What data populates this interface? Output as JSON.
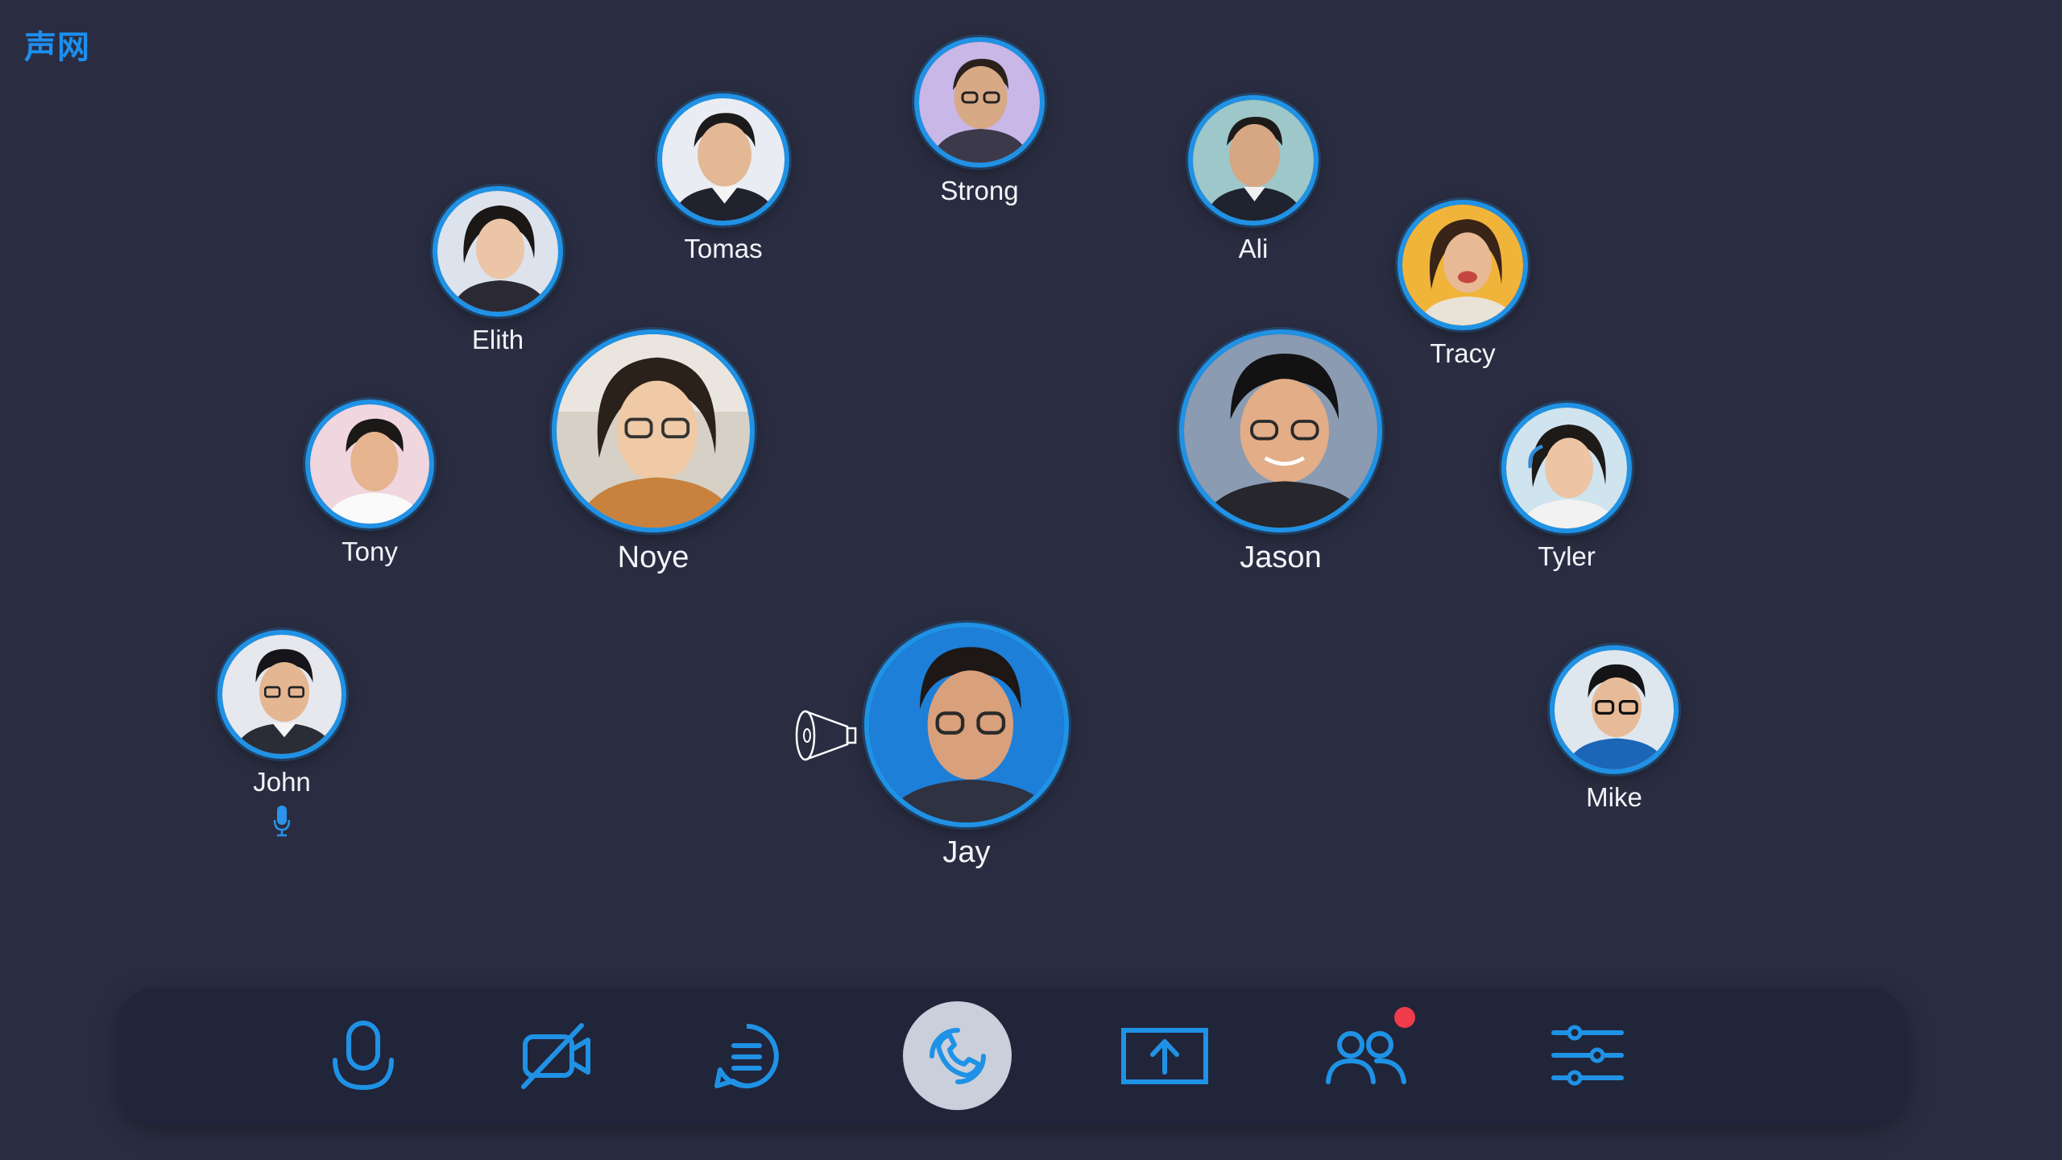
{
  "app": {
    "logo": "声网"
  },
  "participants": [
    {
      "name": "Strong",
      "bg": "#c9b7e8"
    },
    {
      "name": "Tomas",
      "bg": "#e9edf3"
    },
    {
      "name": "Ali",
      "bg": "#9ec7c9"
    },
    {
      "name": "Elith",
      "bg": "#dde3ec"
    },
    {
      "name": "Tracy",
      "bg": "#f1b43a"
    },
    {
      "name": "Noye",
      "bg": "#d6d0c7"
    },
    {
      "name": "Jason",
      "bg": "#8a9bb2"
    },
    {
      "name": "Tony",
      "bg": "#f0d6de"
    },
    {
      "name": "Tyler",
      "bg": "#cfe4ef"
    },
    {
      "name": "John",
      "bg": "#e6e8ee"
    },
    {
      "name": "Jay",
      "bg": "#1d7fd8"
    },
    {
      "name": "Mike",
      "bg": "#dfe7ee"
    }
  ],
  "toolbar": {
    "items": [
      "microphone-icon",
      "camera-off-icon",
      "chat-icon",
      "call-icon",
      "share-screen-icon",
      "participants-icon",
      "settings-icon"
    ]
  },
  "colors": {
    "accent": "#1f92e6",
    "background": "#2a2d41",
    "toolbar": "#21253a",
    "badge": "#ef3b4a"
  }
}
